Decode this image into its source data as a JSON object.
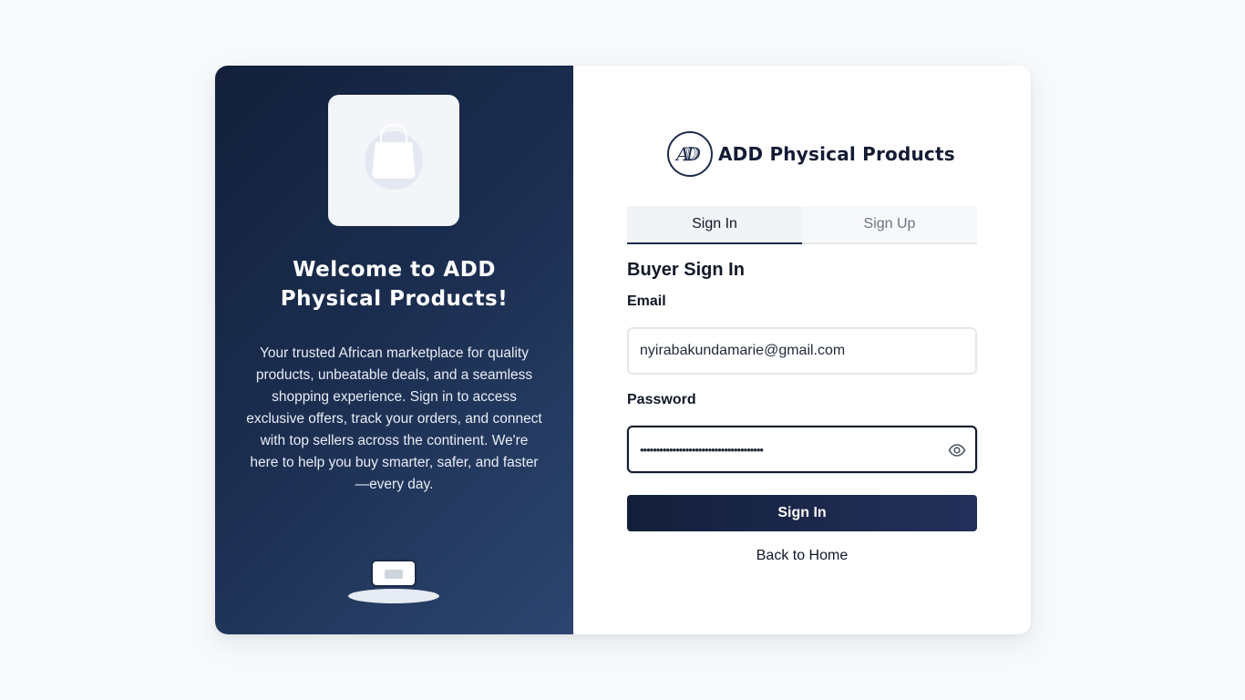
{
  "left_panel": {
    "welcome_title": "Welcome to ADD Physical Products!",
    "description": "Your trusted African marketplace for quality products, unbeatable deals, and a seamless shopping experience. Sign in to access exclusive offers, track your orders, and connect with top sellers across the continent. We're here to help you buy smarter, safer, and faster—every day.",
    "hero_icon": "shopping-bag-icon",
    "bottom_icon": "laptop-icon"
  },
  "brand": {
    "name": "ADD Physical Products",
    "logo": "add-logo"
  },
  "tabs": [
    {
      "label": "Sign In",
      "active": true
    },
    {
      "label": "Sign Up",
      "active": false
    }
  ],
  "form": {
    "title": "Buyer Sign In",
    "email_label": "Email",
    "email_value": "nyirabakundamarie@gmail.com",
    "password_label": "Password",
    "password_value": "••••••••••••••••••••••••••••••••••••••",
    "submit_label": "Sign In",
    "back_label": "Back to Home"
  },
  "colors": {
    "page_bg": "#f7f9fb",
    "panel_gradient_start": "#13203b",
    "panel_gradient_end": "#2c4670",
    "primary_button": "#131f3a",
    "text_dark": "#111827"
  }
}
